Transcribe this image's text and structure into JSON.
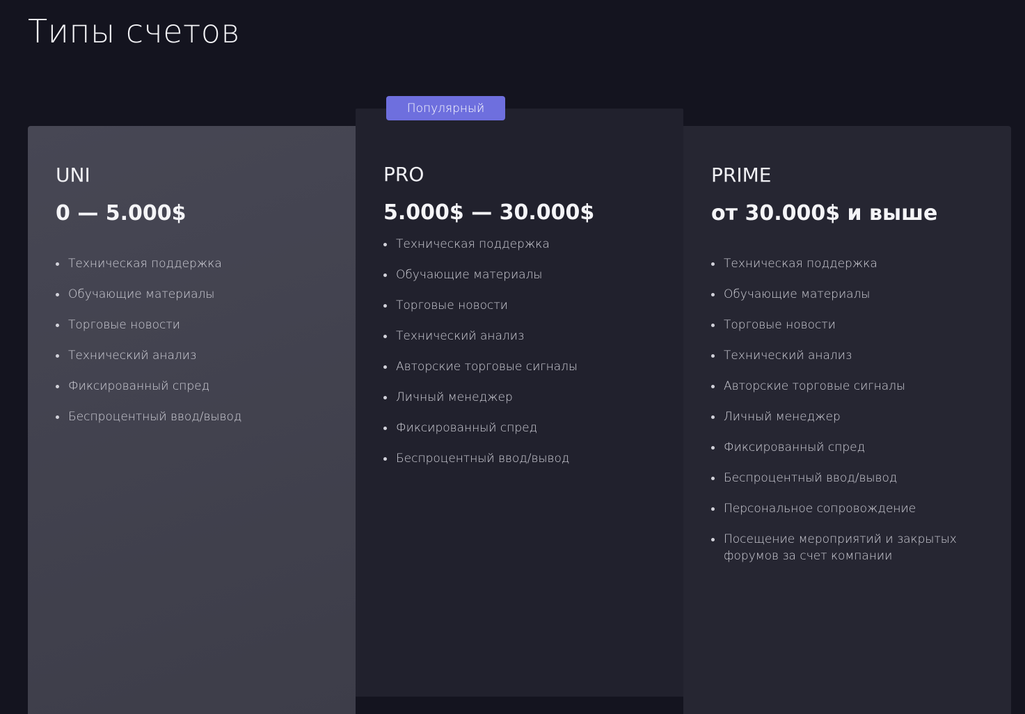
{
  "header": {
    "title": "Типы счетов"
  },
  "plans": [
    {
      "name": "UNI",
      "range": "0 — 5.000$",
      "features": [
        "Техническая поддержка",
        "Обучающие материалы",
        "Торговые новости",
        "Технический анализ",
        "Фиксированный спред",
        "Беспроцентный ввод/вывод"
      ]
    },
    {
      "name": "PRO",
      "badge": "Популярный",
      "range": "5.000$ — 30.000$",
      "features": [
        "Техническая поддержка",
        "Обучающие материалы",
        "Торговые новости",
        "Технический анализ",
        "Авторские торговые сигналы",
        "Личный менеджер",
        "Фиксированный спред",
        "Беспроцентный ввод/вывод"
      ]
    },
    {
      "name": "PRIME",
      "range": "от 30.000$ и выше",
      "features": [
        "Техническая поддержка",
        "Обучающие материалы",
        "Торговые новости",
        "Технический анализ",
        "Авторские торговые сигналы",
        "Личный менеджер",
        "Фиксированный спред",
        "Беспроцентный ввод/вывод",
        "Персональное сопровождение",
        "Посещение мероприятий и закрытых форумов за счет компании"
      ]
    }
  ],
  "colors": {
    "background": "#14141f",
    "accent": "#6e6fde",
    "card_uni": "#474754",
    "card_pro": "#21212d",
    "card_prime": "#262632"
  }
}
